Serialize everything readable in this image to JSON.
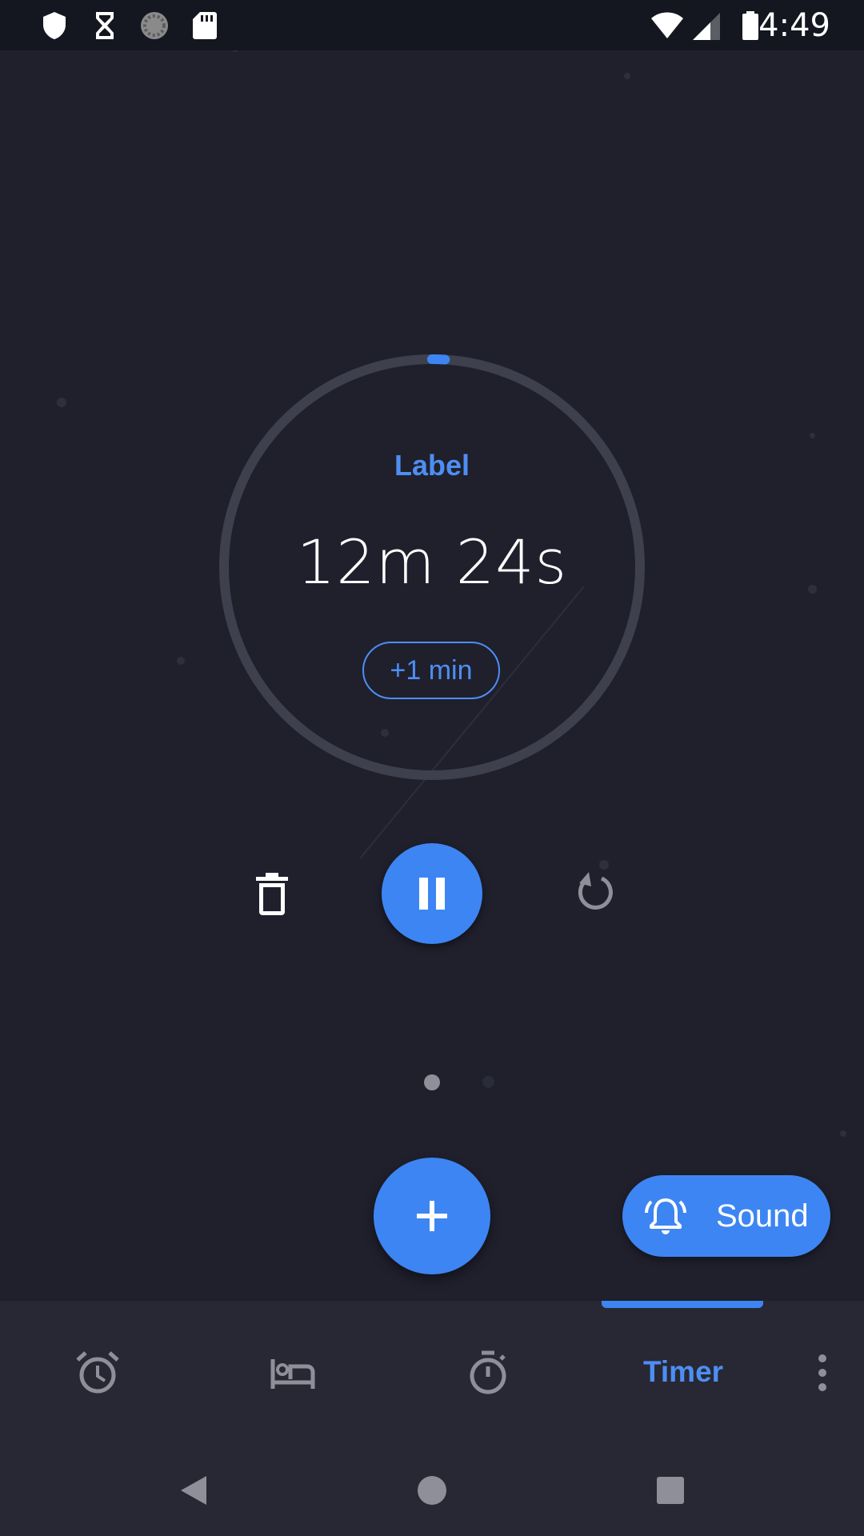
{
  "status_bar": {
    "time": "4:49",
    "left_icons": [
      "shield-icon",
      "hourglass-icon",
      "sync-icon",
      "sd-card-icon"
    ],
    "right_icons": [
      "wifi-icon",
      "cell-signal-icon",
      "battery-icon"
    ]
  },
  "timer": {
    "label": "Label",
    "remaining": "12m 24s",
    "add_minute": "+1 min",
    "progress_elapsed_fraction": 0.02
  },
  "controls": {
    "delete_icon": "delete-icon",
    "pause_icon": "pause-icon",
    "reset_icon": "reset-icon"
  },
  "pager": {
    "pages": 2,
    "current": 1
  },
  "fab": {
    "icon": "plus-icon"
  },
  "sound_button": {
    "label": "Sound",
    "icon": "bell-icon"
  },
  "tabs": {
    "items": [
      {
        "name": "alarm",
        "icon": "alarm-clock-icon"
      },
      {
        "name": "bedtime",
        "icon": "bed-icon"
      },
      {
        "name": "stopwatch",
        "icon": "stopwatch-icon"
      },
      {
        "name": "timer",
        "label": "Timer",
        "selected": true
      }
    ],
    "more_icon": "more-vert-icon"
  },
  "nav_bar": {
    "icons": [
      "back-icon",
      "home-icon",
      "recents-icon"
    ]
  },
  "colors": {
    "accent": "#3d85f3",
    "accent_text": "#4e8ef4",
    "background": "#1f202c",
    "bar_background": "#272834",
    "status_bar": "#141620",
    "ring_track": "#3f404d",
    "inactive_icon": "#8e8f99"
  }
}
